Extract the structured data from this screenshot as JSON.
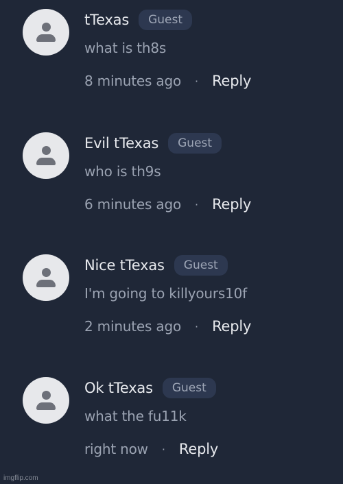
{
  "comments": [
    {
      "username": "tTexas",
      "badge": "Guest",
      "message": "what is th8s",
      "timestamp": "8 minutes ago",
      "separator": "·",
      "reply_label": "Reply"
    },
    {
      "username": "Evil tTexas",
      "badge": "Guest",
      "message": "who is th9s",
      "timestamp": "6 minutes ago",
      "separator": "·",
      "reply_label": "Reply"
    },
    {
      "username": "Nice tTexas",
      "badge": "Guest",
      "message": "I'm going to killyours10f",
      "timestamp": "2 minutes ago",
      "separator": "·",
      "reply_label": "Reply"
    },
    {
      "username": "Ok tTexas",
      "badge": "Guest",
      "message": "what the fu11k",
      "timestamp": "right now",
      "separator": "·",
      "reply_label": "Reply"
    }
  ],
  "watermark": "imgflip.com",
  "colors": {
    "background": "#1f2737",
    "avatar_bg": "#e7e8eb",
    "avatar_icon": "#6d7079",
    "badge_bg": "#2d3850",
    "text_primary": "#e8eaee",
    "text_secondary": "#9ba3b2"
  },
  "icons": {
    "avatar": "user-silhouette-icon"
  }
}
